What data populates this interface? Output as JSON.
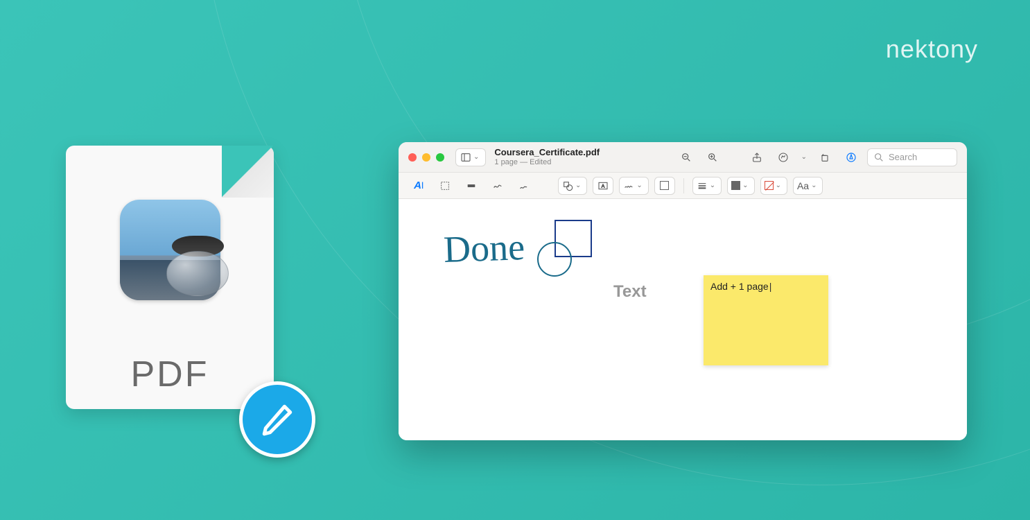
{
  "brand": "nektony",
  "pdf_icon": {
    "label": "PDF"
  },
  "window": {
    "title": "Coursera_Certificate.pdf",
    "subtitle": "1 page — Edited",
    "search_placeholder": "Search",
    "toolbar": {
      "sidebar": "sidebar",
      "zoom_out": "zoom out",
      "zoom_in": "zoom in",
      "share": "share",
      "markup": "markup",
      "rotate": "rotate",
      "highlighter": "highlighter",
      "search_icon": "search"
    },
    "markup_toolbar": {
      "text_style": "A",
      "font_menu": "Aa"
    },
    "annotations": {
      "handwriting": "Done",
      "text_box": "Text",
      "sticky_note": "Add + 1 page"
    }
  },
  "colors": {
    "accent": "#0a7aff",
    "ink": "#1a6b8a",
    "shape": "#1a3b8a"
  }
}
